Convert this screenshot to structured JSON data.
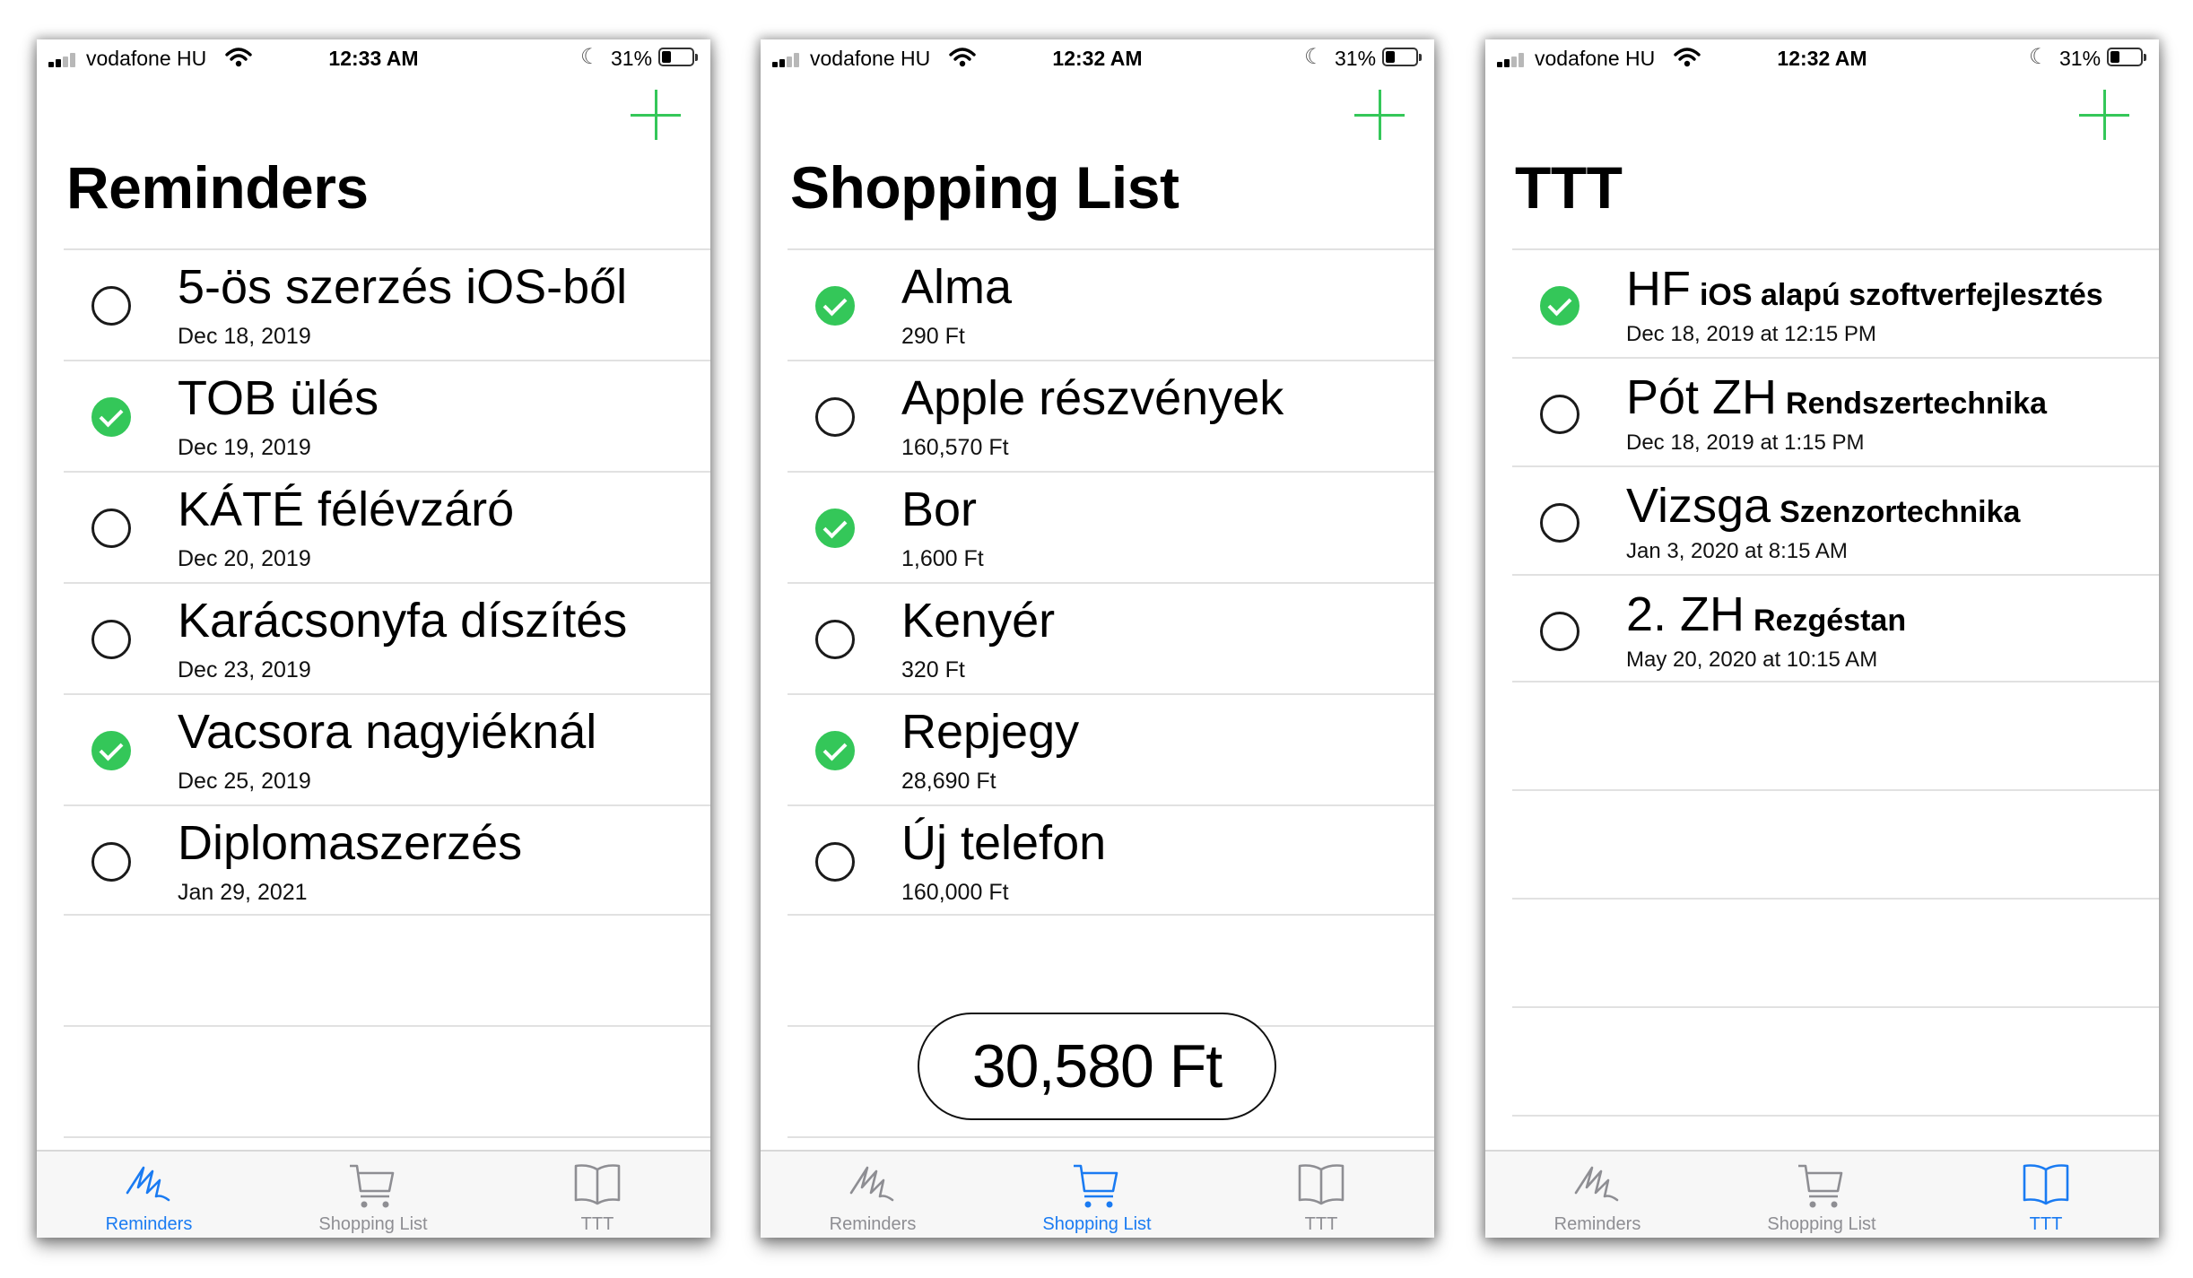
{
  "status": {
    "carrier": "vodafone HU",
    "battery": "31%",
    "times": [
      "12:33 AM",
      "12:32 AM",
      "12:32 AM"
    ]
  },
  "tabs": [
    "Reminders",
    "Shopping List",
    "TTT"
  ],
  "colors": {
    "accent": "#1a7bf2",
    "check": "#34c759",
    "inactive": "#8e8e93"
  },
  "screens": [
    {
      "title": "Reminders",
      "active_tab": 0,
      "items": [
        {
          "title": "5-ös szerzés iOS-ből",
          "sub": "Dec 18, 2019",
          "done": false
        },
        {
          "title": "TOB ülés",
          "sub": "Dec 19, 2019",
          "done": true
        },
        {
          "title": "KÁTÉ félévzáró",
          "sub": "Dec 20, 2019",
          "done": false
        },
        {
          "title": "Karácsonyfa díszítés",
          "sub": "Dec 23, 2019",
          "done": false
        },
        {
          "title": "Vacsora nagyiéknál",
          "sub": "Dec 25, 2019",
          "done": true
        },
        {
          "title": "Diplomaszerzés",
          "sub": "Jan 29, 2021",
          "done": false
        }
      ]
    },
    {
      "title": "Shopping List",
      "active_tab": 1,
      "items": [
        {
          "title": "Alma",
          "sub": "290 Ft",
          "done": true
        },
        {
          "title": "Apple részvények",
          "sub": "160,570 Ft",
          "done": false
        },
        {
          "title": "Bor",
          "sub": "1,600 Ft",
          "done": true
        },
        {
          "title": "Kenyér",
          "sub": "320 Ft",
          "done": false
        },
        {
          "title": "Repjegy",
          "sub": "28,690 Ft",
          "done": true
        },
        {
          "title": "Új telefon",
          "sub": "160,000 Ft",
          "done": false
        }
      ],
      "total": "30,580 Ft"
    },
    {
      "title": "TTT",
      "active_tab": 2,
      "items": [
        {
          "title": "HF",
          "desc": "iOS alapú szoftverfejlesztés",
          "sub": "Dec 18, 2019 at 12:15 PM",
          "done": true
        },
        {
          "title": "Pót ZH",
          "desc": "Rendszertechnika",
          "sub": "Dec 18, 2019 at 1:15 PM",
          "done": false
        },
        {
          "title": "Vizsga",
          "desc": "Szenzortechnika",
          "sub": "Jan 3, 2020 at 8:15 AM",
          "done": false
        },
        {
          "title": "2. ZH",
          "desc": "Rezgéstan",
          "sub": "May 20, 2020 at 10:15 AM",
          "done": false
        }
      ]
    }
  ]
}
